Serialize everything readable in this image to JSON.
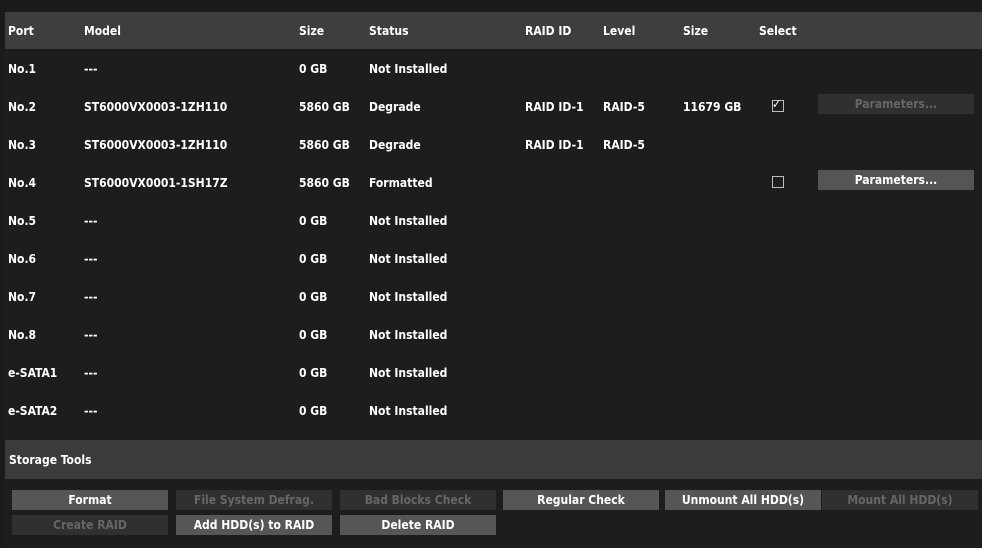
{
  "headers": {
    "port": "Port",
    "model": "Model",
    "size": "Size",
    "status": "Status",
    "raid_id": "RAID ID",
    "level": "Level",
    "size2": "Size",
    "select": "Select"
  },
  "rows": [
    {
      "port": "No.1",
      "model": "---",
      "size": "0 GB",
      "status": "Not Installed",
      "raid_id": "",
      "level": "",
      "size2": ""
    },
    {
      "port": "No.2",
      "model": "ST6000VX0003-1ZH110",
      "size": "5860 GB",
      "status": "Degrade",
      "raid_id": "RAID ID-1",
      "level": "RAID-5",
      "size2": "11679 GB",
      "checked": true,
      "params_label": "Parameters...",
      "params_enabled": false
    },
    {
      "port": "No.3",
      "model": "ST6000VX0003-1ZH110",
      "size": "5860 GB",
      "status": "Degrade",
      "raid_id": "RAID ID-1",
      "level": "RAID-5",
      "size2": ""
    },
    {
      "port": "No.4",
      "model": "ST6000VX0001-1SH17Z",
      "size": "5860 GB",
      "status": "Formatted",
      "raid_id": "",
      "level": "",
      "size2": "",
      "checked": false,
      "params_label": "Parameters...",
      "params_enabled": true
    },
    {
      "port": "No.5",
      "model": "---",
      "size": "0 GB",
      "status": "Not Installed",
      "raid_id": "",
      "level": "",
      "size2": ""
    },
    {
      "port": "No.6",
      "model": "---",
      "size": "0 GB",
      "status": "Not Installed",
      "raid_id": "",
      "level": "",
      "size2": ""
    },
    {
      "port": "No.7",
      "model": "---",
      "size": "0 GB",
      "status": "Not Installed",
      "raid_id": "",
      "level": "",
      "size2": ""
    },
    {
      "port": "No.8",
      "model": "---",
      "size": "0 GB",
      "status": "Not Installed",
      "raid_id": "",
      "level": "",
      "size2": ""
    },
    {
      "port": "e-SATA1",
      "model": "---",
      "size": "0 GB",
      "status": "Not Installed",
      "raid_id": "",
      "level": "",
      "size2": ""
    },
    {
      "port": "e-SATA2",
      "model": "---",
      "size": "0 GB",
      "status": "Not Installed",
      "raid_id": "",
      "level": "",
      "size2": ""
    }
  ],
  "storage_tools": {
    "title": "Storage Tools",
    "buttons_row1": [
      {
        "label": "Format",
        "enabled": true
      },
      {
        "label": "File System Defrag.",
        "enabled": false
      },
      {
        "label": "Bad Blocks Check",
        "enabled": false
      },
      {
        "label": "Regular Check",
        "enabled": true
      },
      {
        "label": "Unmount All HDD(s)",
        "enabled": true
      },
      {
        "label": "Mount All HDD(s)",
        "enabled": false
      }
    ],
    "buttons_row2": [
      {
        "label": "Create RAID",
        "enabled": false
      },
      {
        "label": "Add HDD(s) to RAID",
        "enabled": true
      },
      {
        "label": "Delete RAID",
        "enabled": true
      }
    ]
  },
  "check_glyph": "✓",
  "colors": {
    "background": "#1d1d1d",
    "header_bar": "#3e3e3e",
    "button_enabled": "#565656",
    "button_disabled": "#303030",
    "text_disabled": "#666666"
  }
}
